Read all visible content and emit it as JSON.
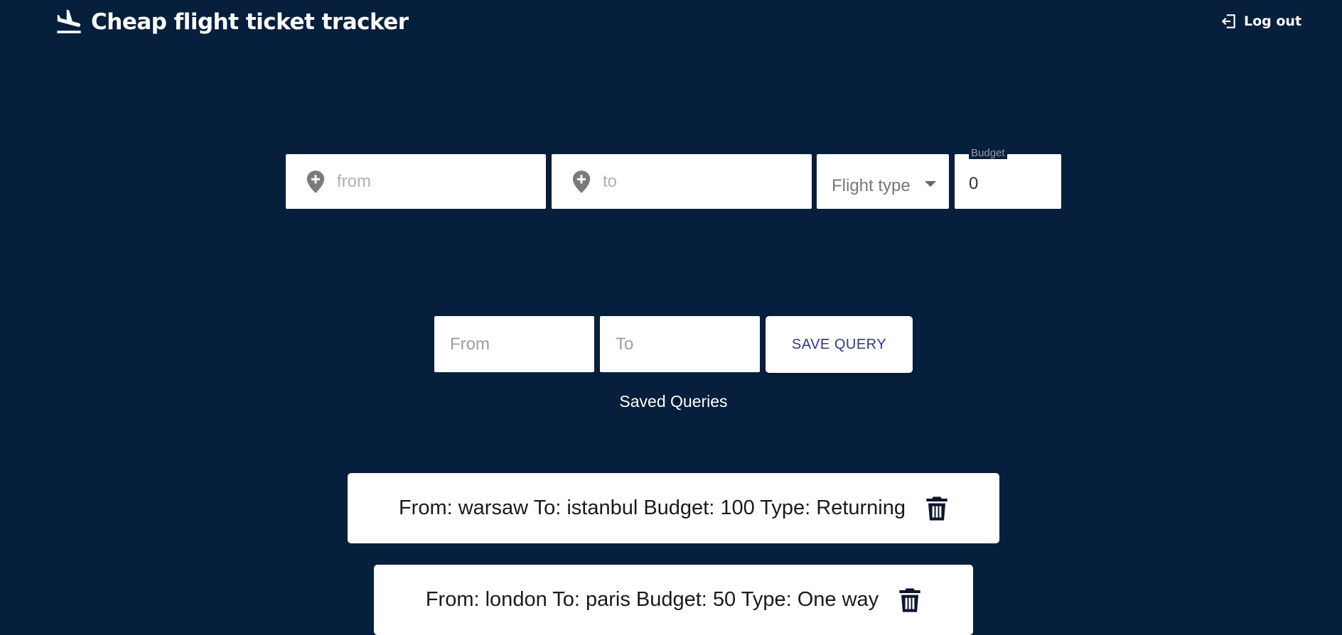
{
  "header": {
    "title": "Cheap flight ticket tracker",
    "brand_icon": "flight-landing-icon",
    "logout_label": "Log out",
    "logout_icon": "logout-icon"
  },
  "search": {
    "from_placeholder": "from",
    "to_placeholder": "to",
    "location_icon": "add-location-icon",
    "flight_type_label": "Flight type",
    "budget_label": "Budget",
    "budget_value": "0"
  },
  "query_form": {
    "from_placeholder": "From",
    "to_placeholder": "To",
    "save_label": "SAVE QUERY"
  },
  "saved": {
    "heading": "Saved Queries",
    "items": [
      {
        "text": "From: warsaw To: istanbul Budget: 100 Type: Returning"
      },
      {
        "text": "From: london To: paris Budget: 50 Type: One way"
      }
    ],
    "delete_icon": "trash-icon"
  },
  "colors": {
    "background": "#061f3d",
    "card": "#ffffff",
    "button_text": "#2b3a8c"
  }
}
